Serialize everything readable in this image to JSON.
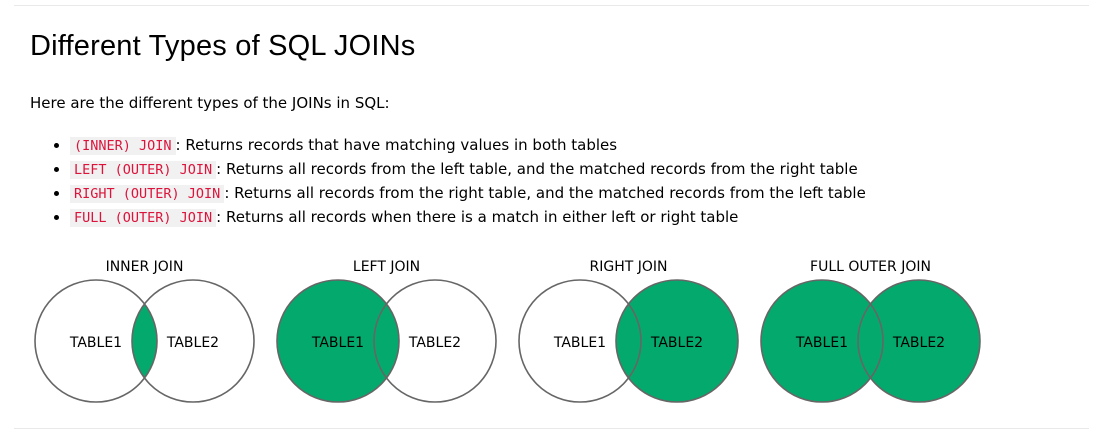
{
  "heading": "Different Types of SQL JOINs",
  "intro": "Here are the different types of the JOINs in SQL:",
  "items": [
    {
      "code": "(INNER) JOIN",
      "text": ": Returns records that have matching values in both tables"
    },
    {
      "code": "LEFT (OUTER) JOIN",
      "text": ": Returns all records from the left table, and the matched records from the right table"
    },
    {
      "code": "RIGHT (OUTER) JOIN",
      "text": ": Returns all records from the right table, and the matched records from the left table"
    },
    {
      "code": "FULL (OUTER) JOIN",
      "text": ": Returns all records when there is a match in either left or right table"
    }
  ],
  "colors": {
    "fill": "#04AA6D",
    "stroke": "#666666",
    "code": "#dc143c"
  },
  "diagrams": [
    {
      "title": "INNER JOIN",
      "left": "TABLE1",
      "right": "TABLE2",
      "highlight": "intersection"
    },
    {
      "title": "LEFT JOIN",
      "left": "TABLE1",
      "right": "TABLE2",
      "highlight": "left"
    },
    {
      "title": "RIGHT JOIN",
      "left": "TABLE1",
      "right": "TABLE2",
      "highlight": "right"
    },
    {
      "title": "FULL OUTER JOIN",
      "left": "TABLE1",
      "right": "TABLE2",
      "highlight": "both"
    }
  ]
}
